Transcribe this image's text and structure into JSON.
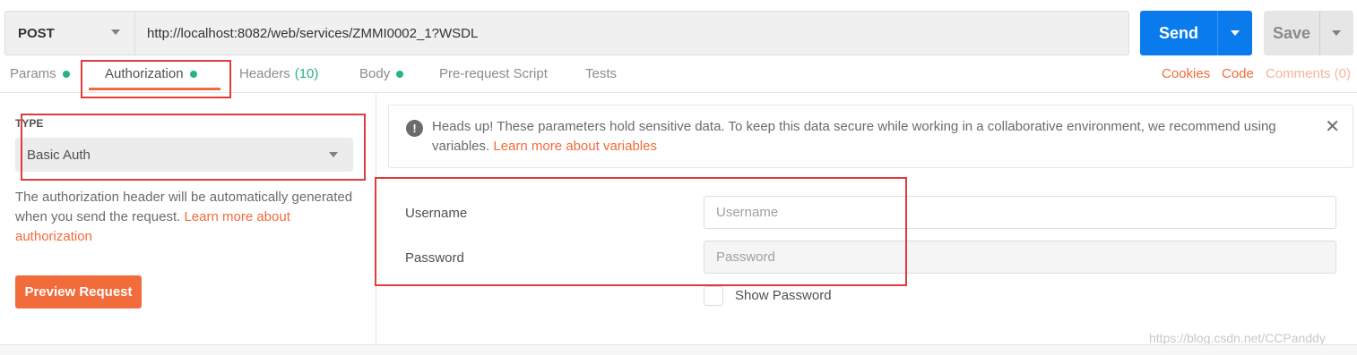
{
  "request": {
    "method": "POST",
    "url": "http://localhost:8082/web/services/ZMMI0002_1?WSDL",
    "send_label": "Send",
    "save_label": "Save"
  },
  "tabs": [
    {
      "label": "Params",
      "dot": true
    },
    {
      "label": "Authorization",
      "dot": true,
      "active": true
    },
    {
      "label": "Headers",
      "count": "(10)"
    },
    {
      "label": "Body",
      "dot": true
    },
    {
      "label": "Pre-request Script"
    },
    {
      "label": "Tests"
    }
  ],
  "right_links": {
    "cookies": "Cookies",
    "code": "Code",
    "comments": "Comments (0)"
  },
  "auth": {
    "type_label": "TYPE",
    "type_value": "Basic Auth",
    "description": "The authorization header will be automatically generated when you send the request. ",
    "description_link": "Learn more about authorization",
    "preview_button": "Preview Request"
  },
  "alert": {
    "text": "Heads up! These parameters hold sensitive data. To keep this data secure while working in a collaborative environment, we recommend using variables. ",
    "link": "Learn more about variables"
  },
  "form": {
    "username_label": "Username",
    "username_placeholder": "Username",
    "password_label": "Password",
    "password_placeholder": "Password",
    "show_password_label": "Show Password"
  },
  "watermark": "https://blog.csdn.net/CCPanddy",
  "colors": {
    "accent_orange": "#f26b3a",
    "send_blue": "#097bed",
    "status_green": "#26b47f",
    "annotation_red": "#e23b3b"
  }
}
